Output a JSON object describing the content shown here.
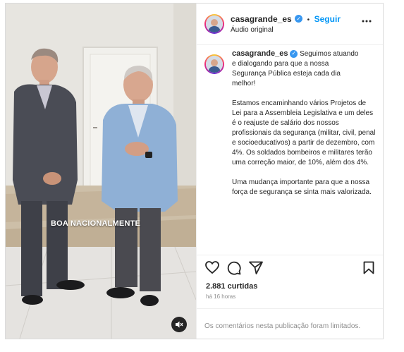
{
  "post": {
    "username": "casagrande_es",
    "follow_label": "Seguir",
    "audio": "Áudio original",
    "video_overlay_text": "BOA NACIONALMENTE",
    "caption_lines": [
      "Seguimos atuando",
      "e dialogando para que a nossa",
      "Segurança Pública esteja cada dia",
      "melhor!"
    ],
    "paragraph_2": "Estamos encaminhando vários Projetos de Lei para a Assembleia Legislativa e um deles é o reajuste de salário dos nossos profissionais da segurança (militar, civil, penal e socioeducativos) a partir de dezembro, com 4%. Os soldados bombeiros e militares terão uma correção maior, de 10%, além dos 4%.",
    "paragraph_3": "Uma mudança importante para que a nossa força de segurança se sinta mais valorizada.",
    "likes": "2.881 curtidas",
    "time_ago": "há 16 horas",
    "comments_limited": "Os comentários nesta publicação foram limitados."
  },
  "icons": {
    "verified": "verified-badge-icon",
    "more": "more-options-icon",
    "like": "heart-icon",
    "comment": "comment-icon",
    "share": "share-icon",
    "save": "bookmark-icon",
    "mute": "muted-speaker-icon"
  },
  "colors": {
    "accent": "#0095f6",
    "verified": "#3897f0",
    "border": "#dbdbdb",
    "muted_text": "#8e8e8e"
  }
}
